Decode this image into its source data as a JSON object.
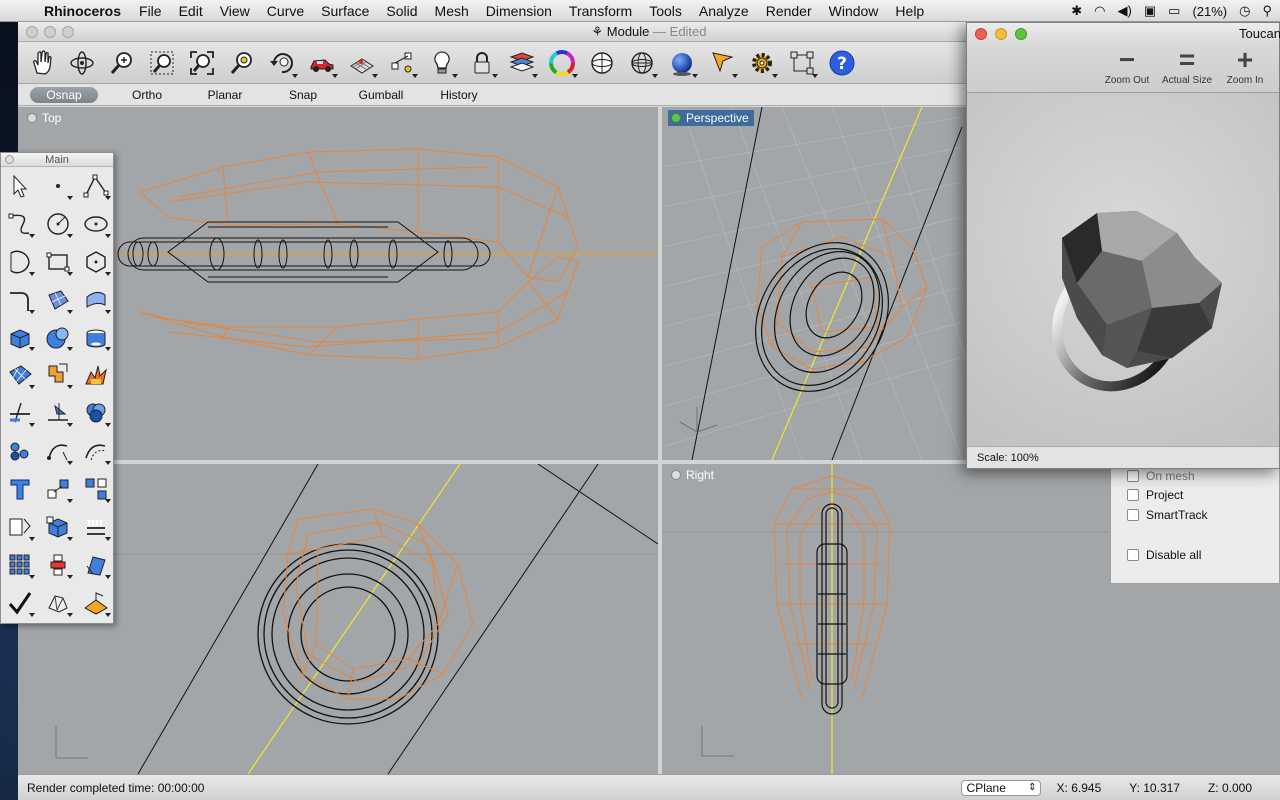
{
  "menubar": {
    "app_name": "Rhinoceros",
    "menus": [
      "File",
      "Edit",
      "View",
      "Curve",
      "Surface",
      "Solid",
      "Mesh",
      "Dimension",
      "Transform",
      "Tools",
      "Analyze",
      "Render",
      "Window",
      "Help"
    ],
    "battery": "(21%)"
  },
  "window": {
    "title": "Module",
    "title_suffix": "— Edited"
  },
  "toolbar": {
    "icons": [
      "pan-icon",
      "rotate-view-icon",
      "zoom-icon",
      "zoom-window-icon",
      "zoom-extents-icon",
      "zoom-selected-icon",
      "undo-view-icon",
      "named-views-icon",
      "cplane-icon",
      "snap-points-icon",
      "lights-icon",
      "lock-icon",
      "layer-icon",
      "color-wheel-icon",
      "wireframe-icon",
      "shaded-icon",
      "rendered-icon",
      "pointer-icon",
      "settings-icon",
      "grid-snap-icon",
      "help-icon"
    ]
  },
  "modes": {
    "items": [
      "Osnap",
      "Ortho",
      "Planar",
      "Snap",
      "Gumball",
      "History"
    ],
    "active": "Osnap"
  },
  "viewports": {
    "top": "Top",
    "perspective": "Perspective",
    "front": "",
    "right": "Right"
  },
  "palette": {
    "title": "Main"
  },
  "osnap_panel": {
    "items": [
      "On mesh",
      "Project",
      "SmartTrack",
      "Disable all"
    ]
  },
  "toucan": {
    "title": "Toucan",
    "zoom_out": "Zoom Out",
    "actual_size": "Actual Size",
    "zoom_in": "Zoom In",
    "scale": "Scale: 100%"
  },
  "statusbar": {
    "message": "Render completed time: 00:00:00",
    "cplane": "CPlane",
    "x": "X: 6.945",
    "y": "Y: 10.317",
    "z": "Z: 0.000"
  },
  "colors": {
    "wire_orange": "#e8843a",
    "axis_yellow": "#f2e62a",
    "viewport_bg": "#a3a6a9",
    "active_view": "#3d6b9b"
  }
}
